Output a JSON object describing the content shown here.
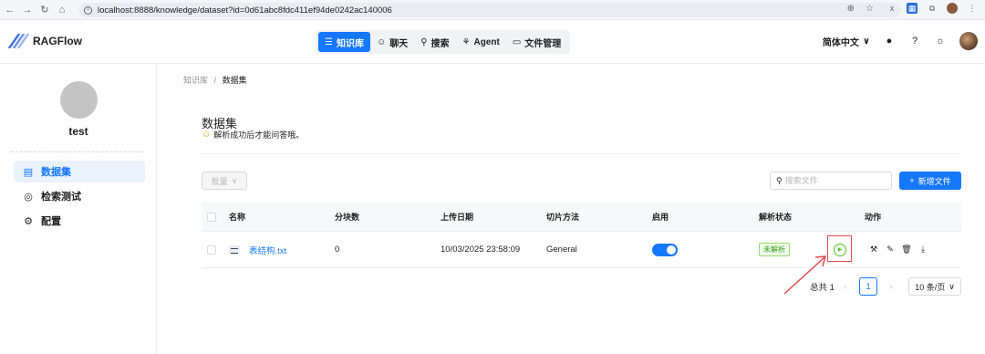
{
  "browser": {
    "url": "localhost:8888/knowledge/dataset?id=0d61abc8fdc411ef94de0242ac140006"
  },
  "app": {
    "name": "RAGFlow",
    "nav": [
      {
        "label": "知识库",
        "icon": "database-icon",
        "active": true
      },
      {
        "label": "聊天",
        "icon": "chat-icon",
        "active": false
      },
      {
        "label": "搜索",
        "icon": "search-icon",
        "active": false
      },
      {
        "label": "Agent",
        "icon": "agent-icon",
        "active": false
      },
      {
        "label": "文件管理",
        "icon": "folder-icon",
        "active": false
      }
    ],
    "language": "简体中文"
  },
  "sidebar": {
    "kb_name": "test",
    "items": [
      {
        "label": "数据集",
        "icon": "document-icon",
        "active": true
      },
      {
        "label": "检索测试",
        "icon": "target-icon",
        "active": false
      },
      {
        "label": "配置",
        "icon": "gear-icon",
        "active": false
      }
    ]
  },
  "main": {
    "breadcrumb": {
      "root": "知识库",
      "separator": "/",
      "current": "数据集"
    },
    "title": "数据集",
    "subtitle": "解析成功后才能问答哦。",
    "bulk_label": "批量",
    "search_placeholder": "搜索文件",
    "new_file_label": "新增文件",
    "columns": [
      "名称",
      "分块数",
      "上传日期",
      "切片方法",
      "启用",
      "解析状态",
      "动作"
    ],
    "rows": [
      {
        "name": "表结构.txt",
        "chunks": "0",
        "upload_date": "10/03/2025 23:58:09",
        "method": "General",
        "enabled": true,
        "status": "未解析"
      }
    ],
    "pagination": {
      "total": "总共 1",
      "current_page": "1",
      "page_size": "10 条/页"
    }
  },
  "colors": {
    "accent": "#1677ff",
    "success": "#52c41a",
    "highlight": "#e5484d"
  }
}
